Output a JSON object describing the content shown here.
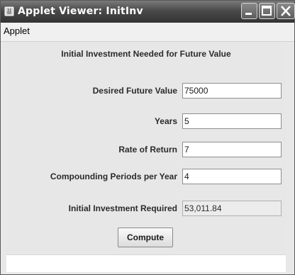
{
  "window": {
    "title": "Applet Viewer: InitInv",
    "icons": [
      "java-icon",
      "minimize-icon",
      "maximize-icon",
      "close-icon"
    ]
  },
  "menu": {
    "items": [
      "Applet"
    ]
  },
  "form": {
    "heading": "Initial Investment Needed for Future Value",
    "fields": [
      {
        "label": "Desired Future Value",
        "value": "75000",
        "editable": true
      },
      {
        "label": "Years",
        "value": "5",
        "editable": true
      },
      {
        "label": "Rate of Return",
        "value": "7",
        "editable": true
      },
      {
        "label": "Compounding Periods per Year",
        "value": "4",
        "editable": true
      },
      {
        "label": "Initial Investment Required",
        "value": "53,011.84",
        "editable": false
      }
    ],
    "button_label": "Compute"
  }
}
